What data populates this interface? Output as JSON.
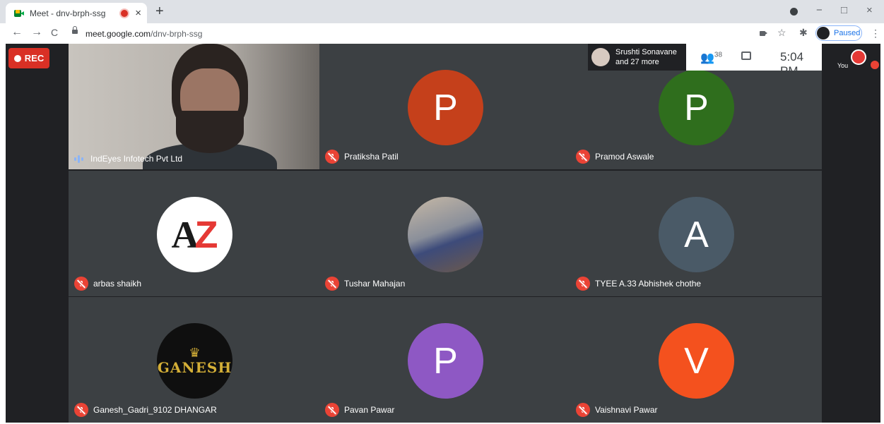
{
  "browser": {
    "tab_title": "Meet - dnv-brph-ssg",
    "tab_close": "×",
    "new_tab": "+",
    "url_host": "meet.google.com",
    "url_path": "/dnv-brph-ssg",
    "profile_status": "Paused",
    "back": "←",
    "forward": "→",
    "reload": "C",
    "star": "☆",
    "menu": "⋮",
    "minimize": "−",
    "maximize": "□",
    "close": "×"
  },
  "meeting": {
    "rec_label": "REC",
    "participants_summary_line1": "Srushti Sonavane",
    "participants_summary_line2": "and 27 more",
    "participant_count": "38",
    "time": "5:04 PM",
    "you_label": "You",
    "accent": "#ea4335"
  },
  "tiles": [
    {
      "name": "IndEyes Infotech Pvt Ltd",
      "type": "video"
    },
    {
      "name": "Pratiksha Patil",
      "initial": "P",
      "color": "#c5401b"
    },
    {
      "name": "Pramod Aswale",
      "initial": "P",
      "color": "#2f6e1d"
    },
    {
      "name": "arbas shaikh",
      "type": "logo-az"
    },
    {
      "name": "Tushar Mahajan",
      "type": "photo"
    },
    {
      "name": "TYEE A.33 Abhishek chothe",
      "initial": "A",
      "color": "#4a5a67"
    },
    {
      "name": "Ganesh_Gadri_9102 DHANGAR",
      "type": "logo-ganesh",
      "logo_text": "GANESH"
    },
    {
      "name": "Pavan Pawar",
      "initial": "P",
      "color": "#8e58c4"
    },
    {
      "name": "Vaishnavi Pawar",
      "initial": "V",
      "color": "#f4511e"
    }
  ]
}
